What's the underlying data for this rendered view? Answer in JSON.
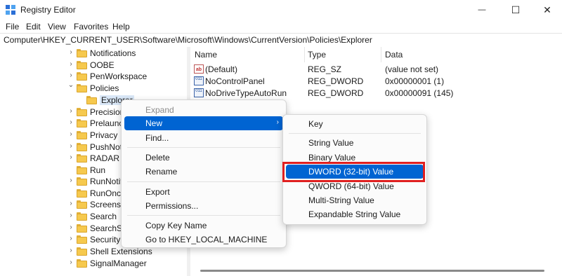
{
  "window": {
    "title": "Registry Editor",
    "controls": {
      "minimize": "—",
      "maximize": "☐",
      "close": "✕"
    }
  },
  "menubar": [
    "File",
    "Edit",
    "View",
    "Favorites",
    "Help"
  ],
  "address": "Computer\\HKEY_CURRENT_USER\\Software\\Microsoft\\Windows\\CurrentVersion\\Policies\\Explorer",
  "tree": {
    "items": [
      {
        "label": "Notifications",
        "chevron": "›"
      },
      {
        "label": "OOBE",
        "chevron": "›"
      },
      {
        "label": "PenWorkspace",
        "chevron": "›"
      },
      {
        "label": "Policies",
        "chevron": "⌄"
      },
      {
        "label": "Explorer",
        "chevron": ""
      },
      {
        "label": "Precision",
        "chevron": "›"
      },
      {
        "label": "Prelaunc",
        "chevron": "›"
      },
      {
        "label": "Privacy",
        "chevron": "›"
      },
      {
        "label": "PushNot",
        "chevron": "›"
      },
      {
        "label": "RADAR",
        "chevron": "›"
      },
      {
        "label": "Run",
        "chevron": ""
      },
      {
        "label": "RunNotif",
        "chevron": "›"
      },
      {
        "label": "RunOnce",
        "chevron": ""
      },
      {
        "label": "Screensa",
        "chevron": "›"
      },
      {
        "label": "Search",
        "chevron": "›"
      },
      {
        "label": "SearchSe",
        "chevron": "›"
      },
      {
        "label": "Security",
        "chevron": "›"
      },
      {
        "label": "Shell Extensions",
        "chevron": "›"
      },
      {
        "label": "SignalManager",
        "chevron": "›"
      }
    ]
  },
  "values": {
    "headers": {
      "name": "Name",
      "type": "Type",
      "data": "Data"
    },
    "rows": [
      {
        "icon": "ab",
        "name": "(Default)",
        "type": "REG_SZ",
        "data": "(value not set)"
      },
      {
        "icon": "011",
        "name": "NoControlPanel",
        "type": "REG_DWORD",
        "data": "0x00000001 (1)"
      },
      {
        "icon": "011",
        "name": "NoDriveTypeAutoRun",
        "type": "REG_DWORD",
        "data": "0x00000091 (145)"
      }
    ]
  },
  "context_menu": {
    "items": [
      "Expand",
      "New",
      "Find...",
      "Delete",
      "Rename",
      "Export",
      "Permissions...",
      "Copy Key Name",
      "Go to HKEY_LOCAL_MACHINE"
    ],
    "submenu_arrow": "›"
  },
  "new_submenu": {
    "items": [
      "Key",
      "String Value",
      "Binary Value",
      "DWORD (32-bit) Value",
      "QWORD (64-bit) Value",
      "Multi-String Value",
      "Expandable String Value"
    ]
  },
  "colors": {
    "highlight": "#0064d2",
    "annotation_box": "#e02020",
    "folder": "#f6c94e"
  }
}
